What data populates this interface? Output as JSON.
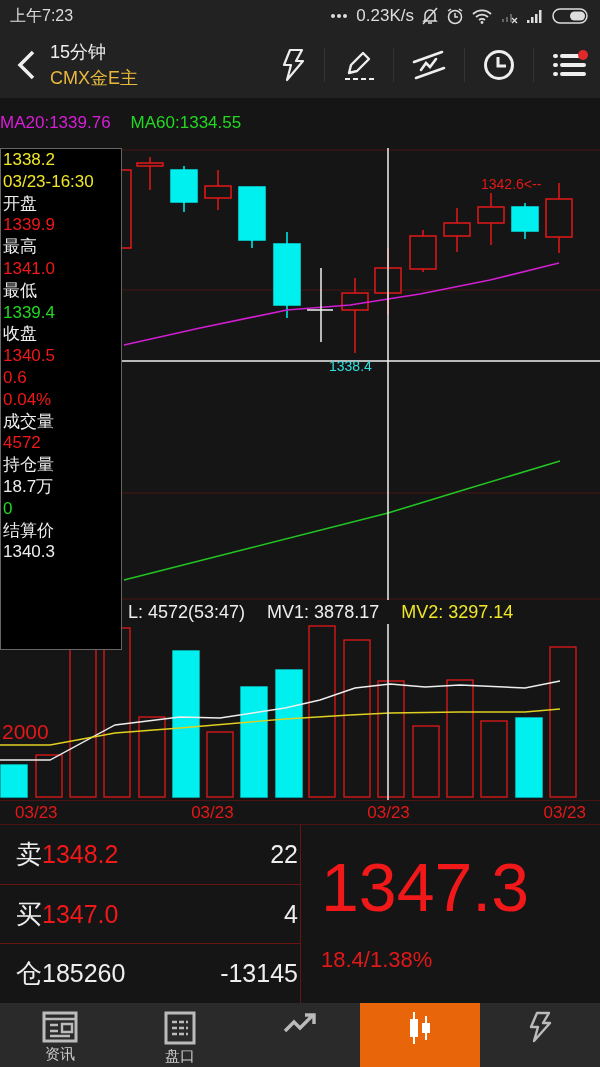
{
  "status_bar": {
    "time": "上午7:23",
    "speed": "0.23K/s"
  },
  "header": {
    "period": "15分钟",
    "symbol": "CMX金E主",
    "menu_badge": true
  },
  "ma_legend": [
    {
      "text": "MA20:1339.76",
      "kind": "ma20"
    },
    {
      "text": "MA60:1334.55",
      "kind": "ma60"
    }
  ],
  "main_chart": {
    "high_label": "1342.6<--",
    "low_label": "1338.4"
  },
  "tooltip": [
    {
      "text": "1338.2",
      "kind": "time"
    },
    {
      "text": "03/23-16:30",
      "kind": "time"
    },
    {
      "text": "开盘",
      "kind": "label"
    },
    {
      "text": "1339.9",
      "kind": "up"
    },
    {
      "text": "最高",
      "kind": "label"
    },
    {
      "text": "1341.0",
      "kind": "up"
    },
    {
      "text": "最低",
      "kind": "label"
    },
    {
      "text": "1339.4",
      "kind": "down"
    },
    {
      "text": "收盘",
      "kind": "label"
    },
    {
      "text": "1340.5",
      "kind": "up"
    },
    {
      "text": "0.6",
      "kind": "up"
    },
    {
      "text": "0.04%",
      "kind": "up"
    },
    {
      "text": "成交量",
      "kind": "label"
    },
    {
      "text": "4572",
      "kind": "up"
    },
    {
      "text": "持仓量",
      "kind": "label"
    },
    {
      "text": "18.7万",
      "kind": "plain"
    },
    {
      "text": "0",
      "kind": "down"
    },
    {
      "text": "结算价",
      "kind": "label"
    },
    {
      "text": "1340.3",
      "kind": "plain"
    }
  ],
  "volume_chart": {
    "legend": [
      {
        "text": "L: 4572(53:47)",
        "kind": "vol"
      },
      {
        "text": "MV1: 3878.17",
        "kind": "mv1"
      },
      {
        "text": "MV2: 3297.14",
        "kind": "mv2"
      }
    ],
    "axis_label": "2000"
  },
  "dates": [
    "03/23",
    "03/23",
    "03/23",
    "03/23"
  ],
  "quote": {
    "rows": [
      {
        "label": "卖",
        "price": "1348.2",
        "qty": "22",
        "kind": "up"
      },
      {
        "label": "买",
        "price": "1347.0",
        "qty": "4",
        "kind": "up"
      },
      {
        "label": "仓",
        "price": "185260",
        "qty": "-13145",
        "kind": "plain"
      }
    ],
    "last": "1347.3",
    "change": "18.4/1.38%"
  },
  "tabs": [
    {
      "label": "资讯",
      "kind": "news",
      "selected": false
    },
    {
      "label": "盘口",
      "kind": "board",
      "selected": false
    },
    {
      "kind": "trend",
      "selected": false
    },
    {
      "kind": "candles",
      "selected": true
    },
    {
      "kind": "flash",
      "selected": false
    }
  ]
}
